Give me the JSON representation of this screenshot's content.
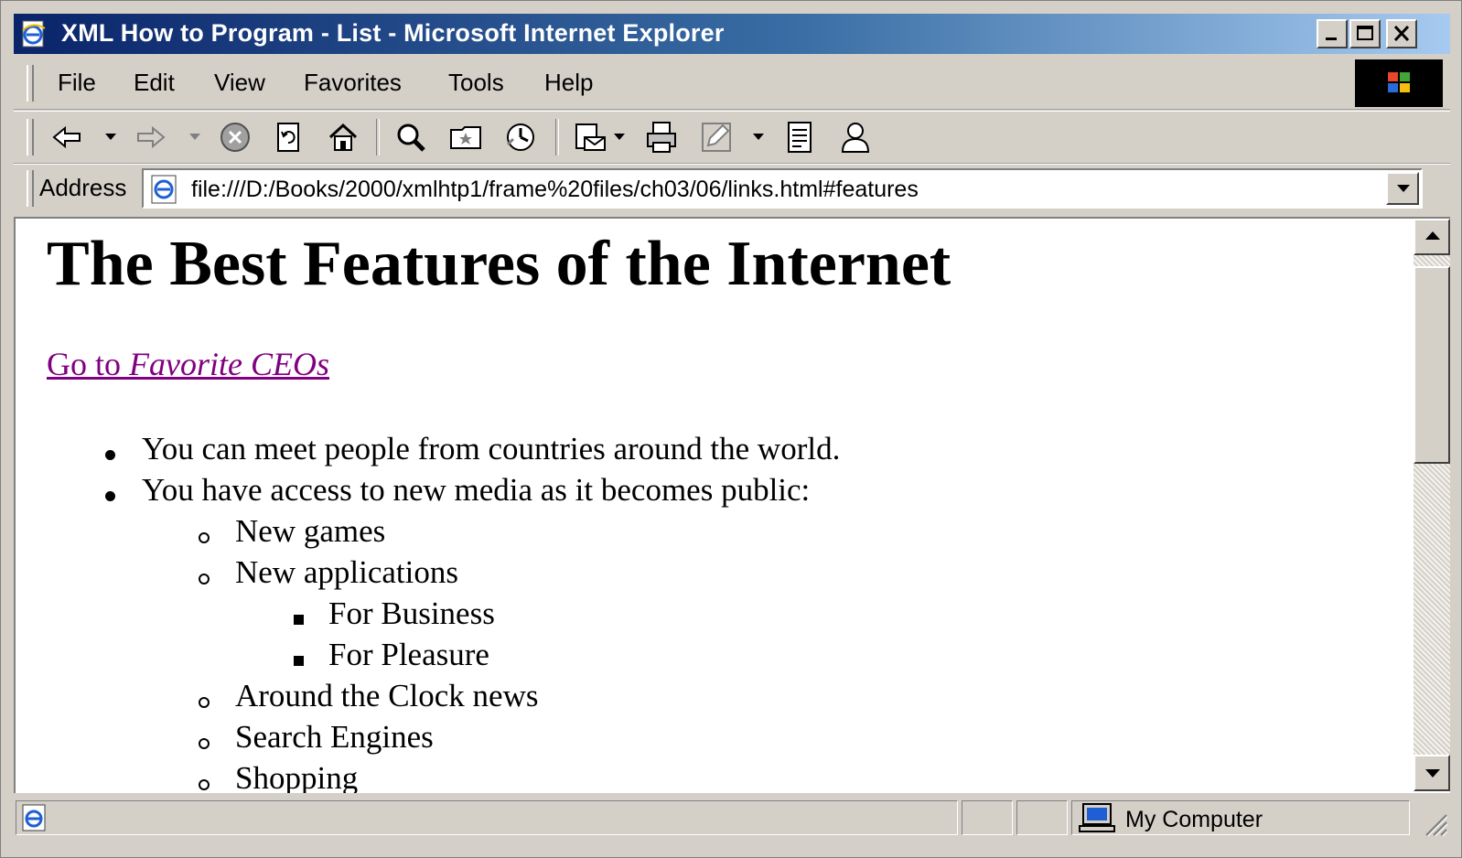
{
  "window": {
    "title": "XML How to Program - List - Microsoft Internet Explorer"
  },
  "menu": {
    "items": [
      "File",
      "Edit",
      "View",
      "Favorites",
      "Tools",
      "Help"
    ]
  },
  "toolbar": {
    "icons": [
      "back-icon",
      "forward-icon",
      "stop-icon",
      "refresh-icon",
      "home-icon",
      "search-icon",
      "favorites-icon",
      "history-icon",
      "mail-icon",
      "print-icon",
      "edit-icon",
      "discuss-icon",
      "messenger-icon"
    ]
  },
  "address": {
    "label": "Address",
    "url": "file:///D:/Books/2000/xmlhtp1/frame%20files/ch03/06/links.html#features"
  },
  "page": {
    "heading": "The Best Features of the Internet",
    "link_prefix": "Go to ",
    "link_italic": "Favorite CEOs",
    "list": {
      "item1": "You can meet people from countries around the world.",
      "item2": "You have access to new media as it becomes public:",
      "sub": {
        "games": "New games",
        "apps": "New applications",
        "apps_sub": [
          "For Business",
          "For Pleasure"
        ],
        "news": "Around the Clock news",
        "search": "Search Engines",
        "shopping": "Shopping"
      }
    }
  },
  "status": {
    "zone": "My Computer"
  },
  "colors": {
    "titlebar_start": "#0a246a",
    "titlebar_end": "#a6caf0",
    "visited_link": "#800080",
    "chrome": "#d4d0c8"
  }
}
